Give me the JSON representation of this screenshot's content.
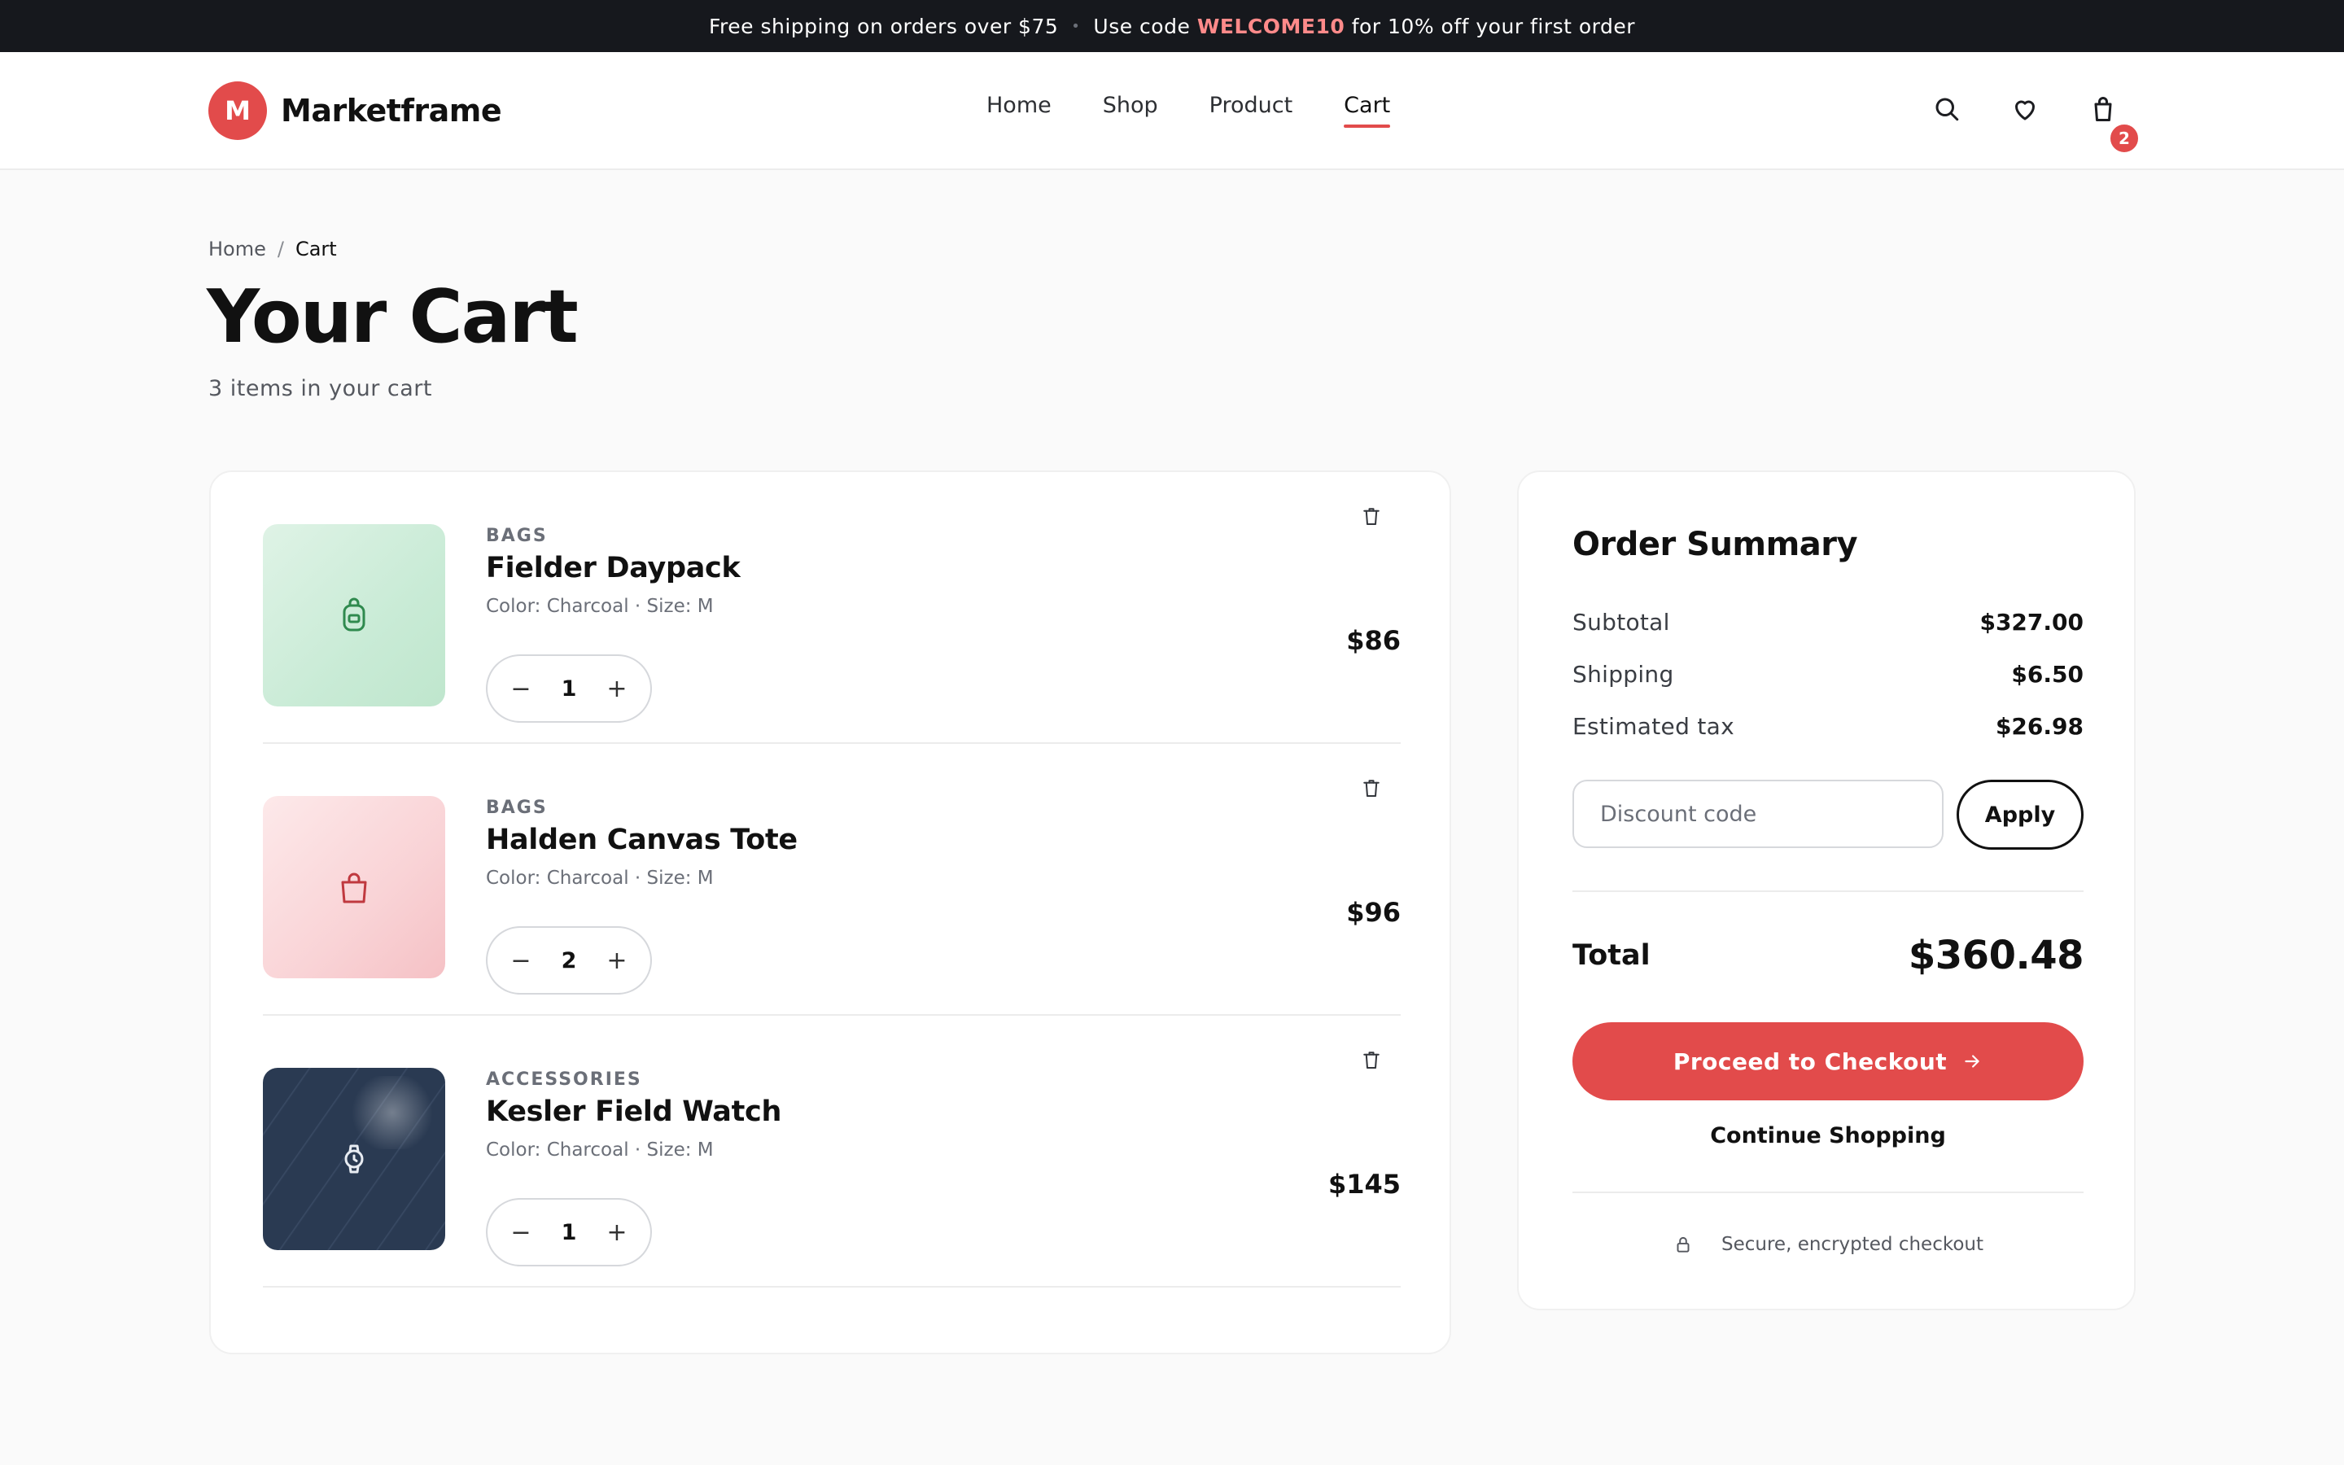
{
  "promo": {
    "shipping_text": "Free shipping on orders over $75",
    "separator": "•",
    "code_prefix": "Use code",
    "code": "WELCOME10",
    "code_suffix": "for 10% off your first order"
  },
  "header": {
    "brand_initial": "M",
    "brand_name": "Marketframe",
    "nav": [
      "Home",
      "Shop",
      "Product",
      "Cart"
    ],
    "active_nav": "Cart",
    "cart_badge": "2",
    "icons": [
      "search-icon",
      "heart-icon",
      "shopping-bag-icon"
    ]
  },
  "breadcrumb": {
    "home": "Home",
    "separator": "/",
    "current": "Cart"
  },
  "page": {
    "title": "Your Cart",
    "subtitle": "3 items in your cart"
  },
  "cart": {
    "items": [
      {
        "category": "BAGS",
        "name": "Fielder Daypack",
        "meta": "Color: Charcoal · Size: M",
        "qty": "1",
        "price": "$86",
        "icon": "backpack-icon",
        "thumb_color": "#c9ebd6"
      },
      {
        "category": "BAGS",
        "name": "Halden Canvas Tote",
        "meta": "Color: Charcoal · Size: M",
        "qty": "2",
        "price": "$96",
        "icon": "tote-bag-icon",
        "thumb_color": "#f9d3d6"
      },
      {
        "category": "ACCESSORIES",
        "name": "Kesler Field Watch",
        "meta": "Color: Charcoal · Size: M",
        "qty": "1",
        "price": "$145",
        "icon": "watch-icon",
        "thumb_color": "#2a3a52"
      }
    ]
  },
  "summary": {
    "title": "Order Summary",
    "subtotal_label": "Subtotal",
    "subtotal": "$327.00",
    "shipping_label": "Shipping",
    "shipping": "$6.50",
    "tax_label": "Estimated tax",
    "tax": "$26.98",
    "discount_placeholder": "Discount code",
    "apply_label": "Apply",
    "total_label": "Total",
    "total": "$360.48",
    "checkout_label": "Proceed to Checkout",
    "continue_label": "Continue Shopping",
    "secure_text": "Secure, encrypted checkout"
  },
  "colors": {
    "accent": "#e24b4b",
    "promo_bg": "#16181d",
    "promo_code": "#ff8a8a"
  }
}
